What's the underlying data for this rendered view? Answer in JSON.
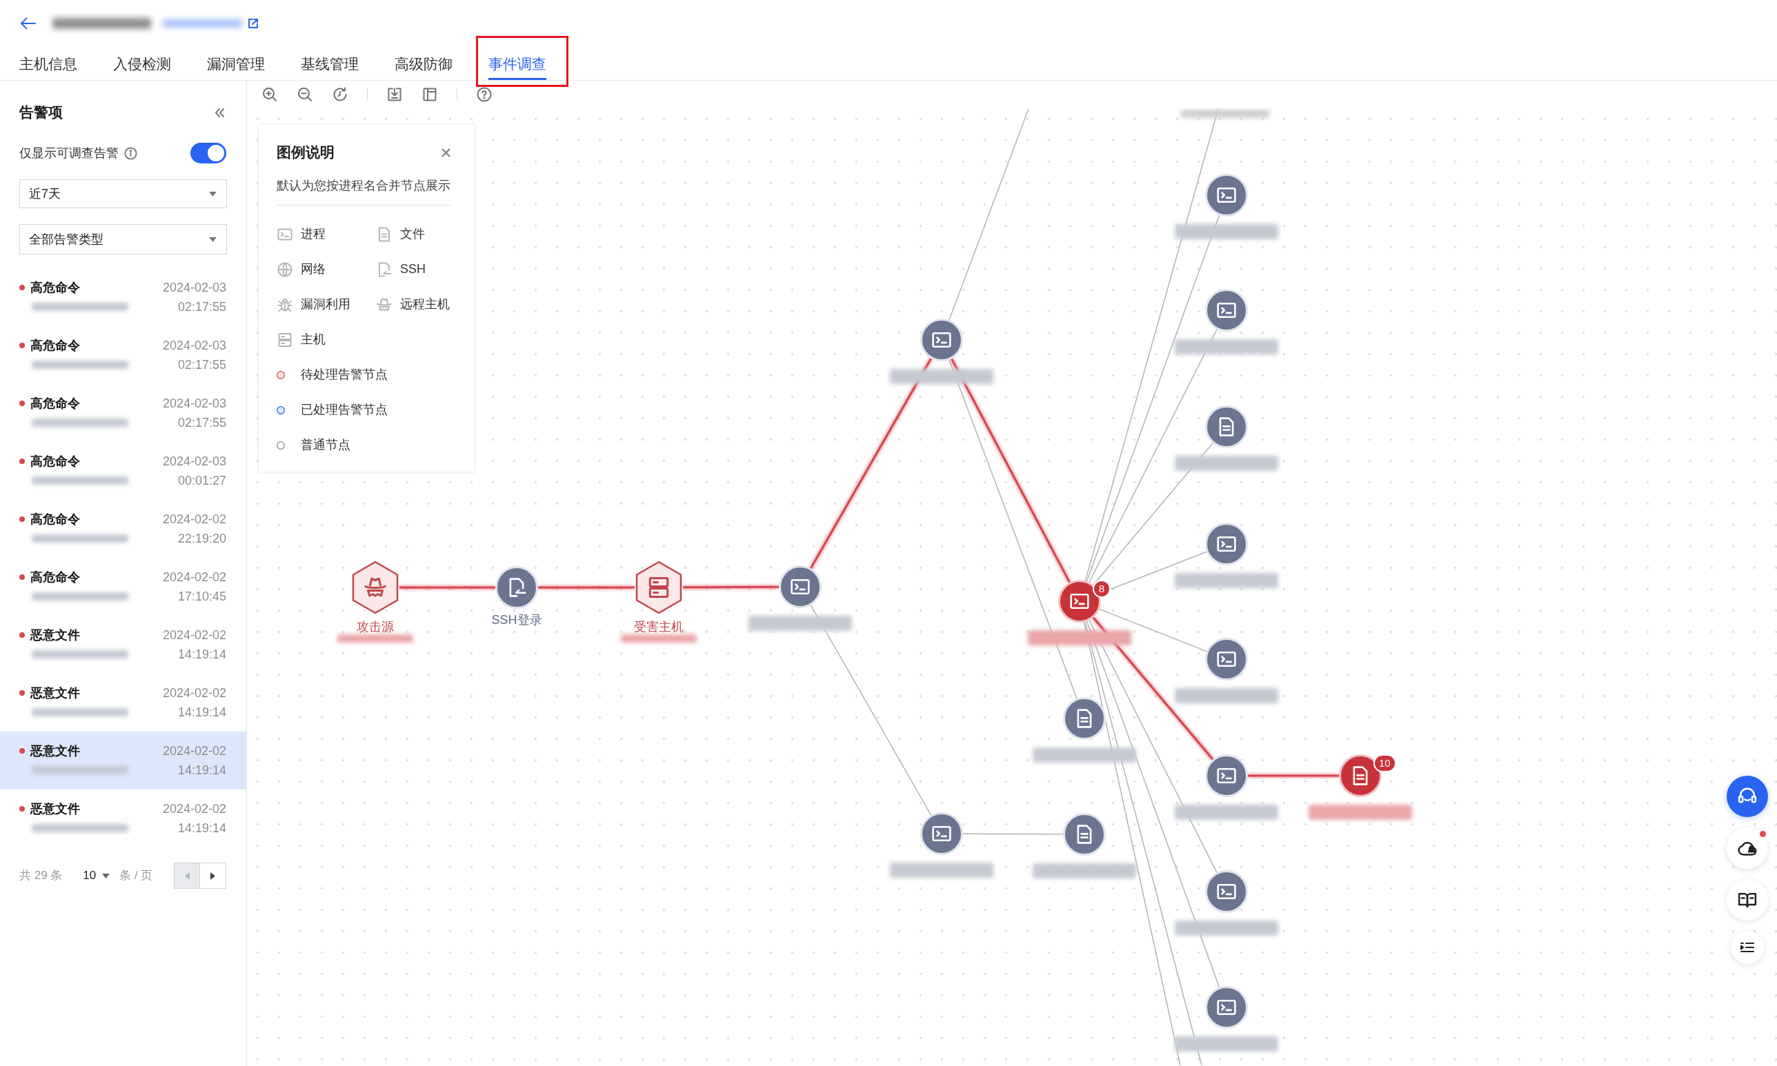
{
  "tabs": [
    {
      "label": "主机信息",
      "selected": false,
      "framed": false
    },
    {
      "label": "入侵检测",
      "selected": false,
      "framed": false
    },
    {
      "label": "漏洞管理",
      "selected": false,
      "framed": false
    },
    {
      "label": "基线管理",
      "selected": false,
      "framed": false
    },
    {
      "label": "高级防御",
      "selected": false,
      "framed": false
    },
    {
      "label": "事件调查",
      "selected": true,
      "framed": true
    }
  ],
  "sidebar": {
    "title": "告警项",
    "only_investigable": {
      "label": "仅显示可调查告警",
      "on": true
    },
    "time_range": {
      "value": "近7天"
    },
    "alert_type": {
      "value": "全部告警类型"
    },
    "alerts": [
      {
        "title": "高危命令",
        "date": "2024-02-03",
        "time": "02:17:55",
        "selected": false
      },
      {
        "title": "高危命令",
        "date": "2024-02-03",
        "time": "02:17:55",
        "selected": false
      },
      {
        "title": "高危命令",
        "date": "2024-02-03",
        "time": "02:17:55",
        "selected": false
      },
      {
        "title": "高危命令",
        "date": "2024-02-03",
        "time": "00:01:27",
        "selected": false
      },
      {
        "title": "高危命令",
        "date": "2024-02-02",
        "time": "22:19:20",
        "selected": false
      },
      {
        "title": "高危命令",
        "date": "2024-02-02",
        "time": "17:10:45",
        "selected": false
      },
      {
        "title": "恶意文件",
        "date": "2024-02-02",
        "time": "14:19:14",
        "selected": false
      },
      {
        "title": "恶意文件",
        "date": "2024-02-02",
        "time": "14:19:14",
        "selected": false
      },
      {
        "title": "恶意文件",
        "date": "2024-02-02",
        "time": "14:19:14",
        "selected": true
      },
      {
        "title": "恶意文件",
        "date": "2024-02-02",
        "time": "14:19:14",
        "selected": false
      }
    ],
    "pagination": {
      "total": "共 29 条",
      "page_size": "10",
      "unit": "条 / 页",
      "prev_disabled": true,
      "next_disabled": false
    }
  },
  "legend": {
    "title": "图例说明",
    "description": "默认为您按进程名合并节点展示",
    "items": [
      {
        "kind": "process",
        "label": "进程"
      },
      {
        "kind": "file",
        "label": "文件"
      },
      {
        "kind": "network",
        "label": "网络"
      },
      {
        "kind": "ssh",
        "label": "SSH"
      },
      {
        "kind": "exploit",
        "label": "漏洞利用"
      },
      {
        "kind": "remote_host",
        "label": "远程主机"
      },
      {
        "kind": "host",
        "label": "主机"
      },
      {
        "kind": "pending",
        "label": "待处理告警节点"
      },
      {
        "kind": "handled",
        "label": "已处理告警节点"
      },
      {
        "kind": "normal",
        "label": "普通节点"
      }
    ]
  },
  "graph": {
    "nodes": [
      {
        "kind": "remote_host",
        "pending_alert": true,
        "label": "攻击源",
        "redacted": true,
        "children": [
          {
            "kind": "ssh",
            "pending_alert": false,
            "label": "SSH登录",
            "redacted": false,
            "alert_link": true,
            "children": [
              {
                "kind": "host",
                "pending_alert": true,
                "label": "受害主机",
                "redacted": true,
                "alert_link": true,
                "children": [
                  {
                    "kind": "process",
                    "pending_alert": false,
                    "redacted": true,
                    "alert_link": true,
                    "children": [
                      {
                        "kind": "process",
                        "pending_alert": false,
                        "redacted": true,
                        "alert_link": true,
                        "children": [
                          {
                            "kind": "process",
                            "pending_alert": true,
                            "badge": "8",
                            "redacted": true,
                            "alert_link": true,
                            "children": [
                              {
                                "kind": "process",
                                "pending_alert": false,
                                "redacted": true,
                                "alert_link": false
                              },
                              {
                                "kind": "process",
                                "pending_alert": false,
                                "redacted": true,
                                "alert_link": false
                              },
                              {
                                "kind": "file",
                                "pending_alert": false,
                                "redacted": true,
                                "alert_link": false
                              },
                              {
                                "kind": "process",
                                "pending_alert": false,
                                "redacted": true,
                                "alert_link": false
                              },
                              {
                                "kind": "process",
                                "pending_alert": false,
                                "redacted": true,
                                "alert_link": false
                              },
                              {
                                "kind": "process",
                                "pending_alert": false,
                                "redacted": true,
                                "alert_link": true,
                                "children": [
                                  {
                                    "kind": "file",
                                    "pending_alert": true,
                                    "badge": "10",
                                    "redacted": true,
                                    "alert_link": true
                                  }
                                ]
                              },
                              {
                                "kind": "process",
                                "pending_alert": false,
                                "redacted": true,
                                "alert_link": false
                              },
                              {
                                "kind": "process",
                                "pending_alert": false,
                                "redacted": true,
                                "alert_link": false
                              }
                            ]
                          },
                          {
                            "kind": "file",
                            "pending_alert": false,
                            "redacted": true,
                            "alert_link": false
                          }
                        ]
                      },
                      {
                        "kind": "process",
                        "pending_alert": false,
                        "redacted": true,
                        "alert_link": false,
                        "children": [
                          {
                            "kind": "file",
                            "pending_alert": false,
                            "redacted": true,
                            "alert_link": false
                          }
                        ]
                      }
                    ]
                  }
                ]
              }
            ]
          }
        ]
      }
    ]
  }
}
